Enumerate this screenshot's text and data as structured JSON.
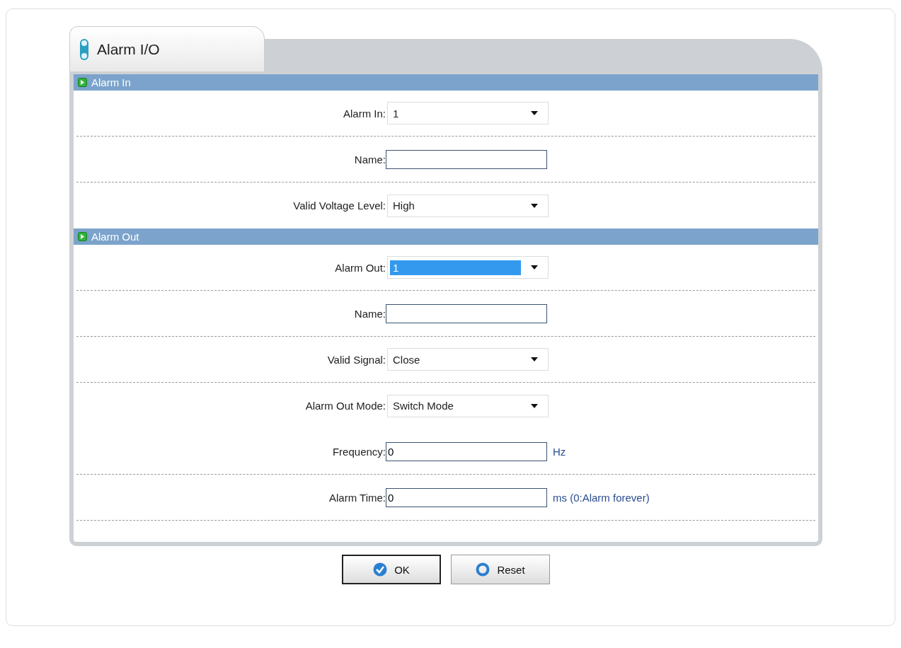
{
  "tab": {
    "label": "Alarm I/O",
    "selected": true
  },
  "sections": [
    {
      "title": "Alarm In",
      "rows": [
        {
          "label": "Alarm In:",
          "kind": "select",
          "value": "1",
          "focused": false,
          "divider": true
        },
        {
          "label": "Name:",
          "kind": "text",
          "value": "",
          "divider": true
        },
        {
          "label": "Valid Voltage Level:",
          "kind": "select",
          "value": "High",
          "focused": false,
          "divider": false
        }
      ]
    },
    {
      "title": "Alarm Out",
      "rows": [
        {
          "label": "Alarm Out:",
          "kind": "select",
          "value": "1",
          "focused": true,
          "divider": true
        },
        {
          "label": "Name:",
          "kind": "text",
          "value": "",
          "divider": true
        },
        {
          "label": "Valid Signal:",
          "kind": "select",
          "value": "Close",
          "focused": false,
          "divider": true
        },
        {
          "label": "Alarm Out Mode:",
          "kind": "select",
          "value": "Switch Mode",
          "focused": false,
          "divider": false
        },
        {
          "label": "Frequency:",
          "kind": "text",
          "value": "0",
          "unit": "Hz",
          "divider": true
        },
        {
          "label": "Alarm Time:",
          "kind": "text",
          "value": "0",
          "unit": "ms (0:Alarm forever)",
          "divider": true
        }
      ]
    }
  ],
  "buttons": [
    {
      "label": "OK",
      "kind": "ok"
    },
    {
      "label": "Reset",
      "kind": "reset"
    }
  ]
}
